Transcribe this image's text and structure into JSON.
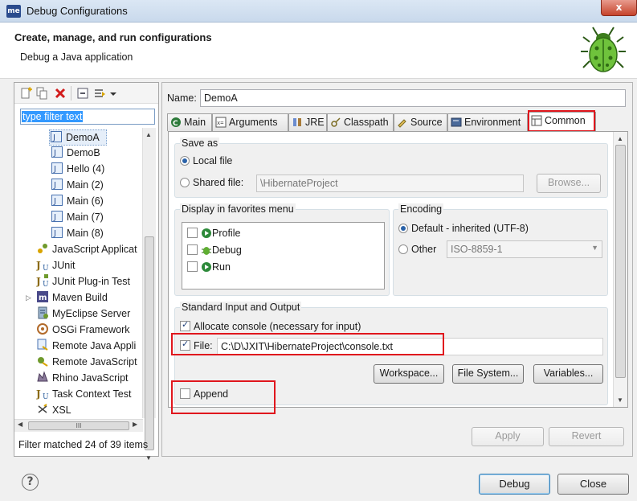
{
  "window": {
    "title": "Debug Configurations",
    "app_icon": "me",
    "close_glyph": "x"
  },
  "header": {
    "title": "Create, manage, and run configurations",
    "subtitle": "Debug a Java application"
  },
  "sidebar": {
    "filter_value": "type filter text",
    "items": [
      {
        "label": "DemoA",
        "icon": "java-class-icon",
        "selected": true
      },
      {
        "label": "DemoB",
        "icon": "java-class-icon"
      },
      {
        "label": "Hello (4)",
        "icon": "java-class-icon"
      },
      {
        "label": "Main (2)",
        "icon": "java-class-icon"
      },
      {
        "label": "Main (6)",
        "icon": "java-class-icon"
      },
      {
        "label": "Main (7)",
        "icon": "java-class-icon"
      },
      {
        "label": "Main (8)",
        "icon": "java-class-icon"
      },
      {
        "label": "JavaScript Applicat",
        "icon": "javascript-app-icon"
      },
      {
        "label": "JUnit",
        "icon": "junit-icon"
      },
      {
        "label": "JUnit Plug-in Test",
        "icon": "junit-plugin-icon"
      },
      {
        "label": "Maven Build",
        "icon": "maven-icon"
      },
      {
        "label": "MyEclipse Server",
        "icon": "server-icon"
      },
      {
        "label": "OSGi Framework",
        "icon": "osgi-icon"
      },
      {
        "label": "Remote Java Appli",
        "icon": "remote-java-icon"
      },
      {
        "label": "Remote JavaScript",
        "icon": "remote-javascript-icon"
      },
      {
        "label": "Rhino JavaScript",
        "icon": "rhino-icon"
      },
      {
        "label": "Task Context Test",
        "icon": "task-context-icon"
      },
      {
        "label": "XSL",
        "icon": "xsl-icon"
      }
    ],
    "hscroll_thumb": "III",
    "filter_status": "Filter matched 24 of 39 items"
  },
  "config": {
    "name_label": "Name:",
    "name_value": "DemoA",
    "tabs": [
      {
        "label": "Main",
        "icon": "main-tab-icon"
      },
      {
        "label": "Arguments",
        "icon": "arguments-tab-icon"
      },
      {
        "label": "JRE",
        "icon": "jre-tab-icon"
      },
      {
        "label": "Classpath",
        "icon": "classpath-tab-icon"
      },
      {
        "label": "Source",
        "icon": "source-tab-icon"
      },
      {
        "label": "Environment",
        "icon": "environment-tab-icon"
      },
      {
        "label": "Common",
        "icon": "common-tab-icon",
        "active": true
      }
    ],
    "save_as": {
      "title": "Save as",
      "local_label": "Local file",
      "shared_label": "Shared file:",
      "shared_value": "\\HibernateProject",
      "browse_label": "Browse..."
    },
    "favorites": {
      "title": "Display in favorites menu",
      "items": [
        "Profile",
        "Debug",
        "Run"
      ]
    },
    "encoding": {
      "title": "Encoding",
      "default_label": "Default - inherited (UTF-8)",
      "other_label": "Other",
      "other_value": "ISO-8859-1"
    },
    "io": {
      "title": "Standard Input and Output",
      "allocate_label": "Allocate console (necessary for input)",
      "file_label": "File:",
      "file_value": "C:\\D\\JXIT\\HibernateProject\\console.txt",
      "workspace_label": "Workspace...",
      "filesystem_label": "File System...",
      "variables_label": "Variables...",
      "append_label": "Append"
    },
    "apply_label": "Apply",
    "revert_label": "Revert"
  },
  "footer": {
    "help_glyph": "?",
    "debug_label": "Debug",
    "close_label": "Close"
  },
  "colors": {
    "highlight_box": "#e0161d",
    "selection": "#3399ff"
  }
}
